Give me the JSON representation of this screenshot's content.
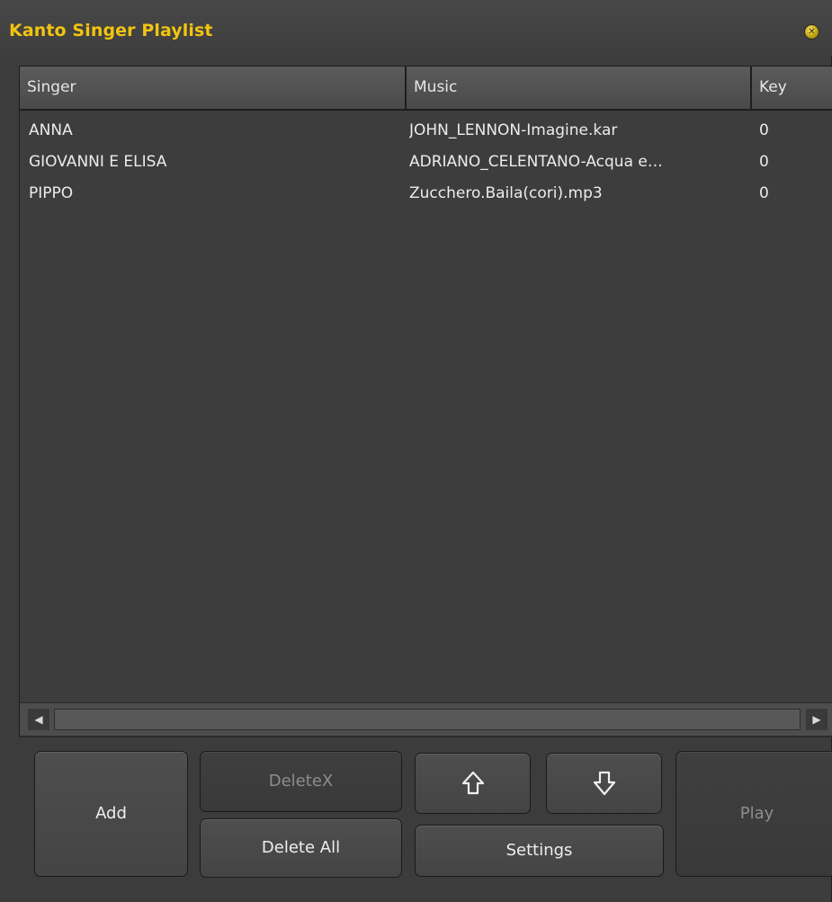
{
  "window": {
    "title": "Kanto Singer Playlist",
    "close_icon": "close-icon",
    "accent_color": "#f2c40f"
  },
  "table": {
    "columns": [
      "Singer",
      "Music",
      "Key"
    ],
    "rows": [
      {
        "singer": "ANNA",
        "music": "JOHN_LENNON-Imagine.kar",
        "key": "0"
      },
      {
        "singer": "GIOVANNI E ELISA",
        "music": "ADRIANO_CELENTANO-Acqua e…",
        "key": "0"
      },
      {
        "singer": "PIPPO",
        "music": "Zucchero.Baila(cori).mp3",
        "key": "0"
      }
    ]
  },
  "buttons": {
    "add": "Add",
    "deletex": "DeleteX",
    "delete_all": "Delete All",
    "move_up_icon": "arrow-up-icon",
    "move_down_icon": "arrow-down-icon",
    "settings": "Settings",
    "play": "Play"
  }
}
